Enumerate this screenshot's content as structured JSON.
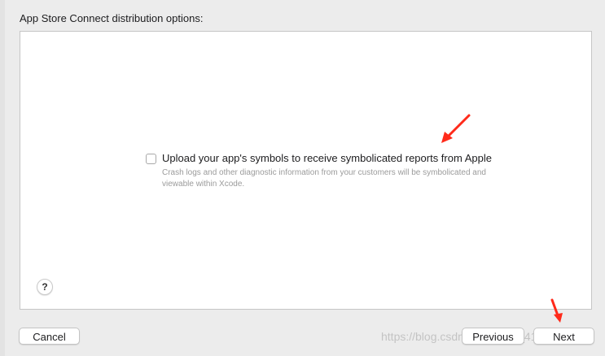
{
  "dialog": {
    "heading": "App Store Connect distribution options:"
  },
  "option": {
    "label": "Upload your app's symbols to receive symbolicated reports from Apple",
    "description": "Crash logs and other diagnostic information from your customers will be symbolicated and viewable within Xcode.",
    "checked": false
  },
  "help": {
    "label": "?"
  },
  "buttons": {
    "cancel": "Cancel",
    "previous": "Previous",
    "next": "Next"
  },
  "watermark": {
    "text": "https://blog.csdn.net/weixin_41963959"
  },
  "colors": {
    "annotation_arrow": "#ff2a1a",
    "window_background": "#ececec",
    "content_background": "#ffffff"
  },
  "icons": {
    "annotation": "red-arrow-icon",
    "help": "question-mark-icon"
  }
}
